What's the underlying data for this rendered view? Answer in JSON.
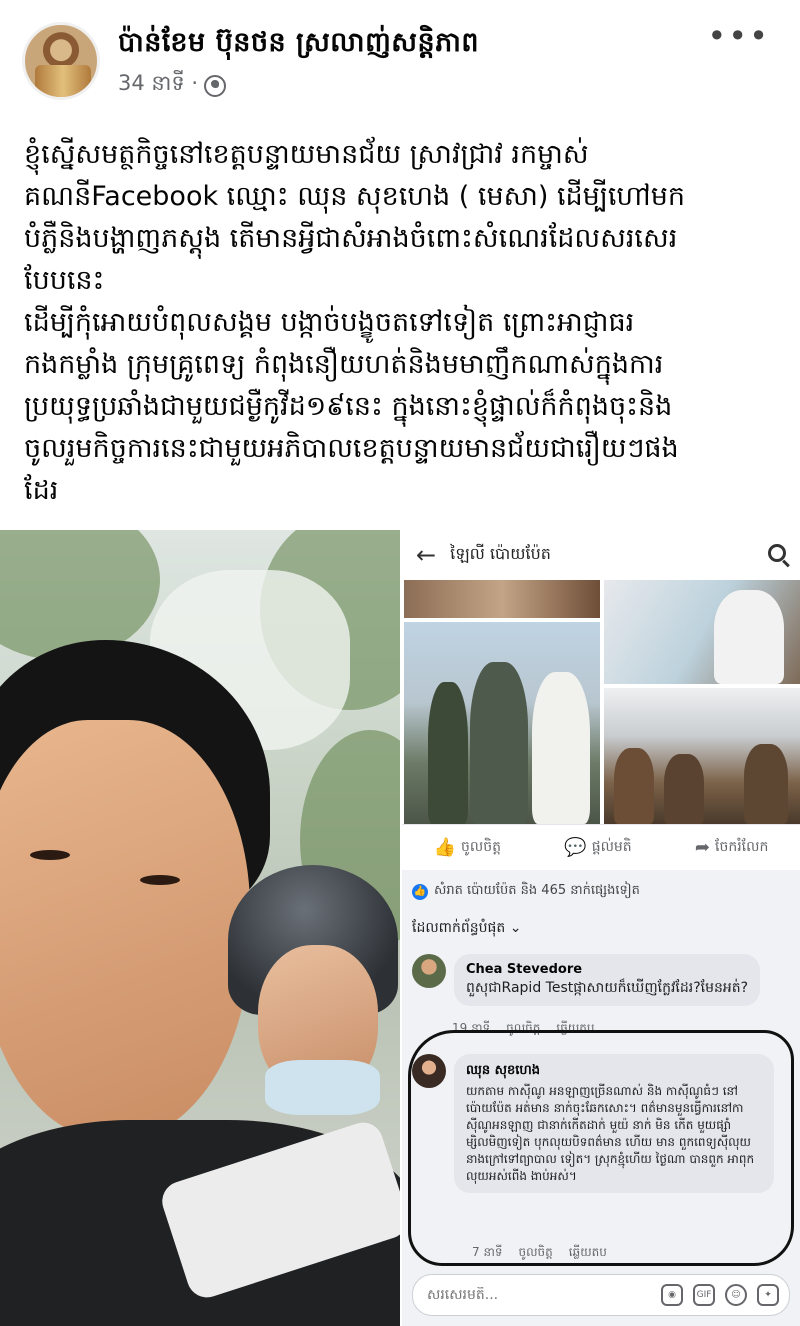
{
  "post": {
    "page_name": "ប៉ាន់ខែម ប៊ុនថន ស្រលាញ់សន្តិភាព",
    "time": "34 នាទី ·",
    "text_lines": [
      "ខ្ញុំស្នើសមត្ថកិច្ចនៅខេត្តបន្ទាយមានជ័យ ស្រាវជ្រាវ រកម្ចាស់",
      "គណនីFacebook ឈ្មោះ ឈុន សុខហេង ( មេសា) ដើម្បីហៅមក",
      "បំភ្លឺនិងបង្ហាញភស្តុង តើមានអ្វីជាសំអាងចំពោះសំណេរដែលសរសេរ",
      "បែបនេះ",
      "ដើម្បីកុំអោយបំពុលសង្គម បង្កាច់បង្ខូចតទៅទៀត ព្រោះអាជ្ញាធរ",
      "កងកម្លាំង ក្រុមគ្រូពេទ្យ កំពុងនឿយហត់និងមមាញឹកណាស់ក្នុងការ",
      "ប្រយុទ្ធប្រឆាំងជាមួយជម្ងឺកូវីដ១៩នេះ ក្នុងនោះខ្ញុំផ្ទាល់ក៏កំពុងចុះនិង",
      "ចូលរួមកិច្ចការនេះជាមួយអភិបាលខេត្តបន្ទាយមានជ័យជារឿយៗផង",
      "ដែរ"
    ]
  },
  "screenshot": {
    "title": "ឡៃលី ប៉ោយប៉ែត",
    "reactions": {
      "like": "ចូលចិត្ត",
      "comment": "ផ្តល់មតិ",
      "share": "ចែករំលែក"
    },
    "likes_summary": "សំរាត ប៉ោយប៉ែត និង 465 នាក់ផ្សេងទៀត",
    "sort_label": "ដែលពាក់ព័ន្ធបំផុត ⌄",
    "comment1": {
      "name": "Chea Stevedore",
      "text": "ពួសុជាRapid Testផ្កាសាយក៏ឃើញក្លែវដែរ?មែនអត់?",
      "time": "19 នាទី",
      "like": "ចូលចិត្ត",
      "reply": "ឆ្លើយតប"
    },
    "comment2": {
      "name": "ឈុន សុខហេង",
      "text": "យកតាម កាស៊ីណូ អនឡាញច្រើនណាស់ និង កាស៊ីណូធំៗ នៅ ប៉ោយប៉ែត អត់មាន នាក់ចុះឆែកសោះ។ ពត៌មានមួនធ្វើការនៅកាស៊ីណូអនឡាញ ជានាក់កើតដាក់ មួយ៉ នាក់ មិន កើត មួយផ្សាំ ម្សិលមិញទៀត បុកលុយបិទពត៌មាន ហើយ មាន ពួកពេទ្យស៊ីលុយនាងក្រៅទៅព្យាបាល ទៀត។ ស្រុកខ្មុំហើយ ថ្ងៃណា បានពួក អាពុក លុយអស់ពើង ងាប់អស់។",
      "time": "7 នាទី",
      "like": "ចូលចិត្ត",
      "reply": "ឆ្លើយតប"
    },
    "composer_placeholder": "សរសេរមតិ..."
  },
  "icons": {
    "more": "more-icon",
    "globe": "globe-icon",
    "back": "back-arrow-icon",
    "search": "search-icon"
  },
  "colors": {
    "meta_gray": "#65676b",
    "like_blue": "#1877f2"
  }
}
